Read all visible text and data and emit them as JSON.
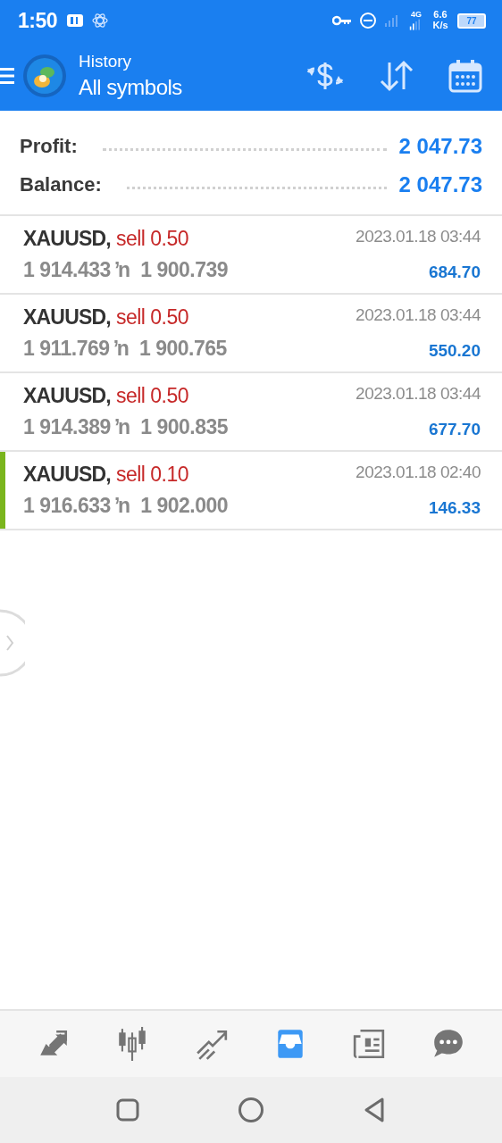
{
  "status_bar": {
    "time": "1:50",
    "network": "4G",
    "speed": "6.6 K/s",
    "battery": "77"
  },
  "header": {
    "title": "History",
    "subtitle": "All symbols"
  },
  "summary": [
    {
      "label": "Profit:",
      "value": "2 047.73"
    },
    {
      "label": "Balance:",
      "value": "2 047.73"
    }
  ],
  "deals": [
    {
      "symbol": "XAUUSD,",
      "side": "sell 0.50",
      "prices": "1 914.433 ŉ  1 900.739",
      "time": "2023.01.18 03:44",
      "profit": "684.70",
      "highlighted": false
    },
    {
      "symbol": "XAUUSD,",
      "side": "sell 0.50",
      "prices": "1 911.769 ŉ  1 900.765",
      "time": "2023.01.18 03:44",
      "profit": "550.20",
      "highlighted": false
    },
    {
      "symbol": "XAUUSD,",
      "side": "sell 0.50",
      "prices": "1 914.389 ŉ  1 900.835",
      "time": "2023.01.18 03:44",
      "profit": "677.70",
      "highlighted": false
    },
    {
      "symbol": "XAUUSD,",
      "side": "sell 0.10",
      "prices": "1 916.633 ŉ  1 902.000",
      "time": "2023.01.18 02:40",
      "profit": "146.33",
      "highlighted": true
    }
  ],
  "bottom_nav": [
    {
      "kind": "quotes",
      "selected": false
    },
    {
      "kind": "chart",
      "selected": false
    },
    {
      "kind": "trade",
      "selected": false
    },
    {
      "kind": "history",
      "selected": true
    },
    {
      "kind": "news",
      "selected": false
    },
    {
      "kind": "chat",
      "selected": false
    }
  ]
}
